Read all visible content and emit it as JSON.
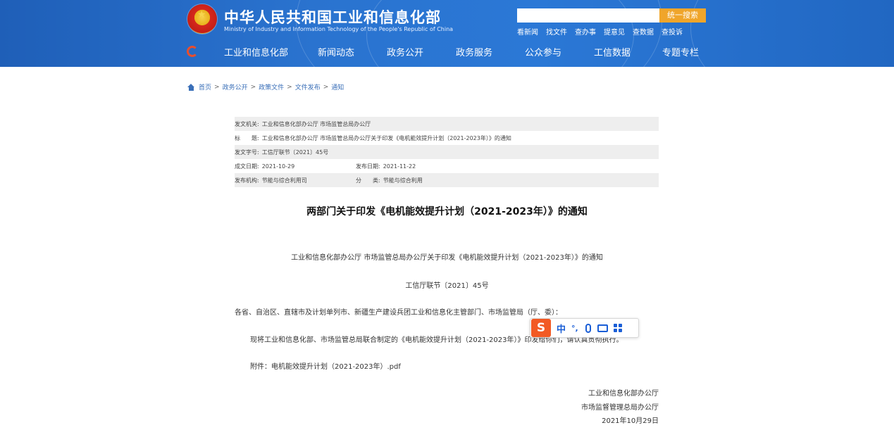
{
  "header": {
    "title_cn": "中华人民共和国工业和信息化部",
    "title_en": "Ministry of Industry and Information Technology of the People's Republic of China",
    "search_placeholder": "",
    "search_button": "统一搜索",
    "quick_links": [
      "看新闻",
      "找文件",
      "查办事",
      "提意见",
      "查数据",
      "查投诉"
    ],
    "nav": [
      "工业和信息化部",
      "新闻动态",
      "政务公开",
      "政务服务",
      "公众参与",
      "工信数据",
      "专题专栏"
    ],
    "colors": {
      "header_blue": "#2a73cf",
      "search_button": "#f0a52a",
      "nav_icon": "#e94e2d"
    }
  },
  "breadcrumb": [
    "首页",
    "政务公开",
    "政策文件",
    "文件发布",
    "通知"
  ],
  "info": {
    "issuer_label": "发文机关:",
    "issuer_value": "工业和信息化部办公厅 市场监管总局办公厅",
    "title_label": "标　　题:",
    "title_value": "工业和信息化部办公厅 市场监管总局办公厅关于印发《电机能效提升计划（2021-2023年）》的通知",
    "docno_label": "发文字号:",
    "docno_value": "工信厅联节〔2021〕45号",
    "written_label": "成文日期:",
    "written_value": "2021-10-29",
    "published_label": "发布日期:",
    "published_value": "2021-11-22",
    "org_label": "发布机构:",
    "org_value": "节能与综合利用司",
    "category_label": "分　　类:",
    "category_value": "节能与综合利用"
  },
  "document": {
    "title": "两部门关于印发《电机能效提升计划（2021-2023年）》的通知",
    "subtitle": "工业和信息化部办公厅 市场监管总局办公厅关于印发《电机能效提升计划（2021-2023年）》的通知",
    "doc_number": "工信厅联节〔2021〕45号",
    "addressee": "各省、自治区、直辖市及计划单列市、新疆生产建设兵团工业和信息化主管部门、市场监管局（厅、委）：",
    "body": "现将工业和信息化部、市场监管总局联合制定的《电机能效提升计划（2021-2023年）》印发给你们，请认真贯彻执行。",
    "attachment": "附件：电机能效提升计划（2021-2023年）.pdf",
    "signer_1": "工业和信息化部办公厅",
    "signer_2": "市场监督管理总局办公厅",
    "sign_date": "2021年10月29日"
  },
  "ime": {
    "logo": "S",
    "mode": "中",
    "punct": "°,",
    "icons": [
      "mic-icon",
      "keyboard-icon",
      "grid-icon"
    ],
    "colors": {
      "logo_bg": "#f25a24",
      "icon": "#1a5ed6"
    }
  }
}
